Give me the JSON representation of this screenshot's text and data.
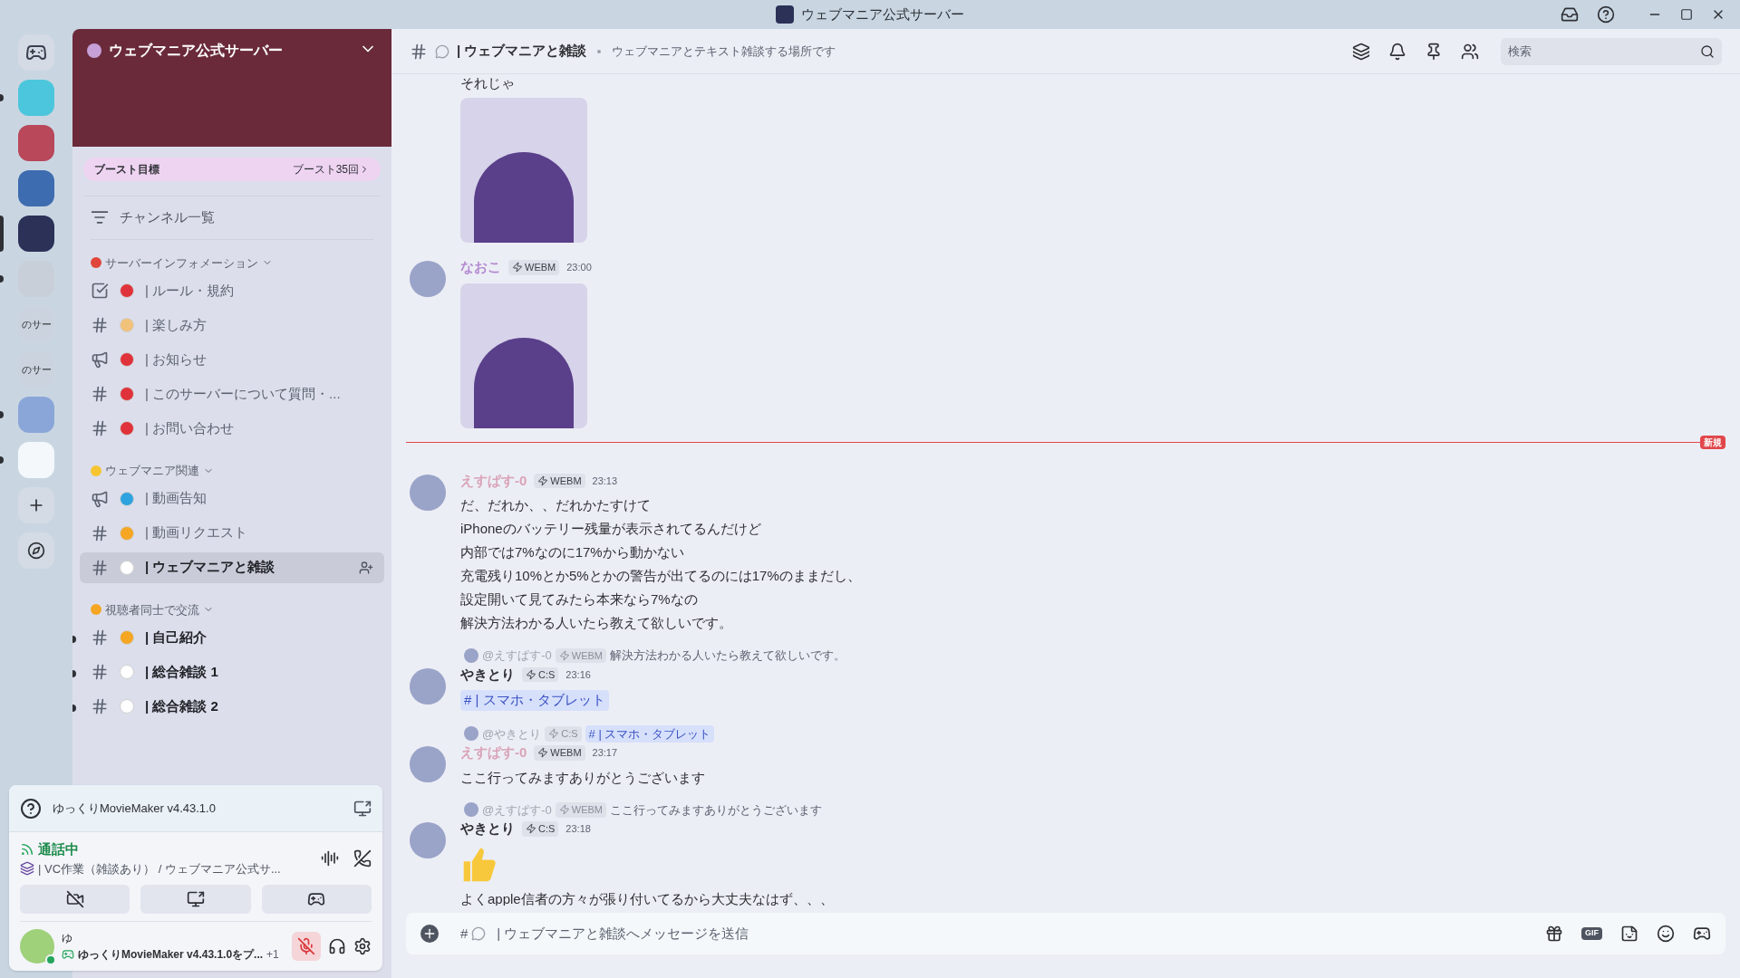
{
  "title_bar": {
    "title": "ウェブマニア公式サーバー"
  },
  "servers": [
    {
      "kind": "home",
      "selected": false,
      "unread": false
    },
    {
      "kind": "image",
      "selected": false,
      "unread": true,
      "color": "#4cc6dc"
    },
    {
      "kind": "image",
      "selected": false,
      "unread": false,
      "color": "#b8485a"
    },
    {
      "kind": "image",
      "selected": false,
      "unread": false,
      "color": "#3e6cb0"
    },
    {
      "kind": "image",
      "selected": true,
      "unread": false,
      "color": "#2c3158"
    },
    {
      "kind": "image",
      "selected": false,
      "unread": true,
      "color": "#c9cfd8"
    },
    {
      "kind": "text",
      "label": "のサー",
      "selected": false,
      "unread": false
    },
    {
      "kind": "text",
      "label": "のサー",
      "selected": false,
      "unread": false
    },
    {
      "kind": "image",
      "selected": false,
      "unread": true,
      "color": "#8aa6d8"
    },
    {
      "kind": "image",
      "selected": false,
      "unread": true,
      "color": "#f4f8fb"
    },
    {
      "kind": "add",
      "selected": false,
      "unread": false
    },
    {
      "kind": "explore",
      "selected": false,
      "unread": false
    }
  ],
  "server": {
    "name": "ウェブマニア公式サーバー",
    "boost_goal": "ブースト目標",
    "boost_count": "ブースト35回"
  },
  "channel_browser": "チャンネル一覧",
  "categories": [
    {
      "name": "サーバーインフォメーション",
      "color": "#e0453a",
      "channels": [
        {
          "kind": "rules",
          "color": "#e0323a",
          "name": "| ルール・規約",
          "selected": false,
          "unread": false
        },
        {
          "kind": "text",
          "color": "#f2c27a",
          "name": "| 楽しみ方",
          "selected": false,
          "unread": false
        },
        {
          "kind": "announcement",
          "color": "#e0323a",
          "name": "| お知らせ",
          "selected": false,
          "unread": false
        },
        {
          "kind": "text",
          "color": "#e0323a",
          "name": "| このサーバーについて質問・...",
          "selected": false,
          "unread": false
        },
        {
          "kind": "text",
          "color": "#e0323a",
          "name": "| お問い合わせ",
          "selected": false,
          "unread": false
        }
      ]
    },
    {
      "name": "ウェブマニア関連",
      "color": "#f7c532",
      "channels": [
        {
          "kind": "announcement",
          "color": "#2ea3e0",
          "name": "| 動画告知",
          "selected": false,
          "unread": false
        },
        {
          "kind": "text",
          "color": "#f5a623",
          "name": "| 動画リクエスト",
          "selected": false,
          "unread": false
        },
        {
          "kind": "text",
          "color": "#ffffff",
          "name": "| ウェブマニアと雑談",
          "selected": true,
          "unread": false
        }
      ]
    },
    {
      "name": "視聴者同士で交流",
      "color": "#f5a623",
      "channels": [
        {
          "kind": "text",
          "color": "#f5a623",
          "name": "| 自己紹介",
          "selected": false,
          "unread": true
        },
        {
          "kind": "text",
          "color": "#ffffff",
          "name": "| 総合雑談 1",
          "selected": false,
          "unread": true
        },
        {
          "kind": "text",
          "color": "#ffffff",
          "name": "| 総合雑談 2",
          "selected": false,
          "unread": true
        }
      ]
    }
  ],
  "activity": {
    "app": "ゆっくりMovieMaker v4.43.1.0"
  },
  "voice": {
    "status": "通話中",
    "channel": "| VC作業（雑談あり） / ウェブマニア公式サ..."
  },
  "user": {
    "name": "ゆ",
    "activity": "ゆっくりMovieMaker v4.43.1.0をプ...",
    "extra": "+1",
    "online": true,
    "mic_muted": true
  },
  "channel_header": {
    "name": "| ウェブマニアと雑談",
    "topic": "ウェブマニアとテキスト雑談する場所です",
    "search_placeholder": "検索"
  },
  "messages": [
    {
      "kind": "continuation",
      "lines": [
        "それじゃ"
      ],
      "attachment": {
        "kind": "sticker"
      }
    },
    {
      "kind": "message",
      "author": "なおこ",
      "color": "#b48ad0",
      "tag": "WEBM",
      "time": "23:00",
      "attachment": {
        "kind": "sticker"
      }
    },
    {
      "kind": "divider",
      "label": "新規"
    },
    {
      "kind": "message",
      "author": "えすぱす-0",
      "color": "#d9a3b8",
      "tag": "WEBM",
      "time": "23:13",
      "lines": [
        "だ、だれか、、だれかたすけて",
        "iPhoneのバッテリー残量が表示されてるんだけど",
        "内部では7%なのに17%から動かない",
        "充電残り10%とか5%とかの警告が出てるのには17%のままだし、",
        "設定開いて見てみたら本来なら7%なの",
        "解決方法わかる人いたら教えて欲しいです。"
      ]
    },
    {
      "kind": "message",
      "author": "やきとり",
      "color": "#2e3035",
      "tag": "C:S",
      "time": "23:16",
      "reply": {
        "author": "@えすぱす-0",
        "tag": "WEBM",
        "text": "解決方法わかる人いたら教えて欲しいです。"
      },
      "mention": {
        "hash": "#",
        "name": "| スマホ・タブレット"
      }
    },
    {
      "kind": "message",
      "author": "えすぱす-0",
      "color": "#d9a3b8",
      "tag": "WEBM",
      "time": "23:17",
      "reply": {
        "author": "@やきとり",
        "tag": "C:S",
        "mention": {
          "hash": "#",
          "name": "| スマホ・タブレット"
        }
      },
      "lines": [
        "ここ行ってみますありがとうございます"
      ]
    },
    {
      "kind": "message",
      "author": "やきとり",
      "color": "#2e3035",
      "tag": "C:S",
      "time": "23:18",
      "reply": {
        "author": "@えすぱす-0",
        "tag": "WEBM",
        "text": "ここ行ってみますありがとうございます"
      },
      "attachment": {
        "kind": "emoji"
      },
      "lines": [
        "よくapple信者の方々が張り付いてるから大丈夫なはず、、、"
      ]
    }
  ],
  "composer": {
    "prefix": "#",
    "placeholder": "| ウェブマニアと雑談へメッセージを送信",
    "gif": "GIF"
  }
}
